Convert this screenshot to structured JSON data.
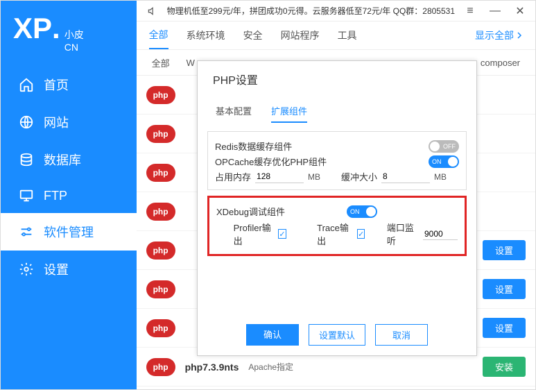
{
  "logo": {
    "big": "XP",
    "dot": ".",
    "t1": "小皮",
    "t2": "CN"
  },
  "nav": [
    {
      "label": "首页",
      "icon": "home"
    },
    {
      "label": "网站",
      "icon": "globe"
    },
    {
      "label": "数据库",
      "icon": "db"
    },
    {
      "label": "FTP",
      "icon": "ftp"
    },
    {
      "label": "软件管理",
      "icon": "sliders",
      "active": true
    },
    {
      "label": "设置",
      "icon": "gear"
    }
  ],
  "announce": "物理机低至299元/年，拼团成功0元得。云服务器低至72元/年   QQ群：2805531",
  "topnav": {
    "tabs": [
      "全部",
      "系统环境",
      "安全",
      "网站程序",
      "工具"
    ],
    "active": 0,
    "showall": "显示全部"
  },
  "filterbar": {
    "left": [
      "全部",
      "W"
    ],
    "right": "composer"
  },
  "rows": [
    {
      "name": "",
      "action": ""
    },
    {
      "name": "",
      "action": ""
    },
    {
      "name": "",
      "action": ""
    },
    {
      "name": "",
      "action": ""
    },
    {
      "name": "",
      "action": "设置",
      "cls": "cfg"
    },
    {
      "name": "",
      "action": "设置",
      "cls": "cfg"
    },
    {
      "name": "",
      "action": "设置",
      "cls": "cfg"
    },
    {
      "name": "php7.3.9nts",
      "sub": "Apache指定",
      "action": "安装",
      "cls": "install"
    }
  ],
  "dialog": {
    "title": "PHP设置",
    "tabs": [
      "基本配置",
      "扩展组件"
    ],
    "active": 1,
    "redis": {
      "label": "Redis数据缓存组件",
      "state": "OFF"
    },
    "opcache": {
      "label": "OPCache缓存优化PHP组件",
      "state": "ON"
    },
    "mem": {
      "label": "占用内存",
      "val": "128",
      "unit": "MB"
    },
    "buf": {
      "label": "缓冲大小",
      "val": "8",
      "unit": "MB"
    },
    "xdebug": {
      "label": "XDebug调试组件",
      "state": "ON",
      "profiler": "Profiler输出",
      "trace": "Trace输出",
      "port": "端口监听",
      "portval": "9000"
    },
    "buttons": {
      "ok": "确认",
      "default": "设置默认",
      "cancel": "取消"
    }
  }
}
